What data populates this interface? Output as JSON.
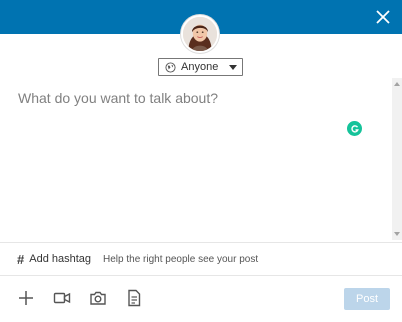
{
  "header": {
    "close_icon": "close-icon",
    "color": "#0073b1"
  },
  "audience": {
    "label": "Anyone",
    "icon": "globe-icon"
  },
  "editor": {
    "placeholder": "What do you want to talk about?",
    "value": ""
  },
  "hashtag": {
    "label": "Add hashtag",
    "hint": "Help the right people see your post"
  },
  "toolbar": {
    "icons": [
      "plus-icon",
      "video-icon",
      "camera-icon",
      "document-icon"
    ],
    "post_label": "Post"
  },
  "colors": {
    "accent": "#0073b1",
    "post_disabled": "#bcd5ea",
    "grammarly": "#15c39a"
  }
}
